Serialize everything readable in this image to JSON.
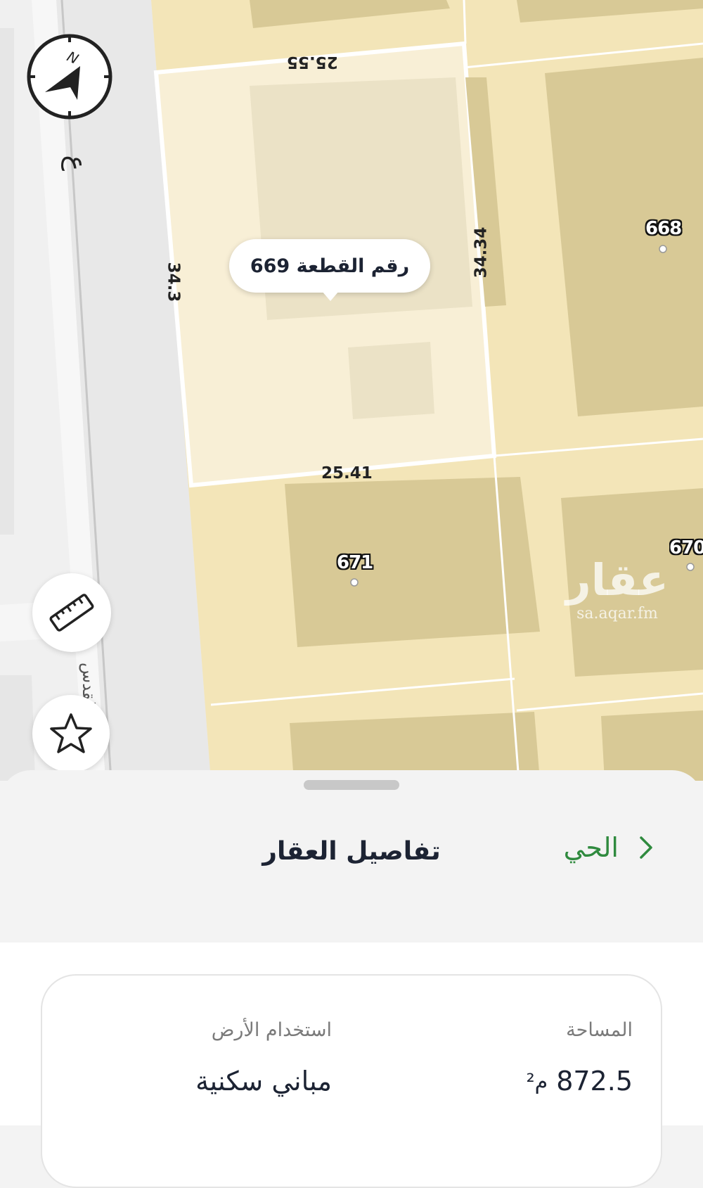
{
  "map": {
    "compass_label": "N",
    "street_label_top": "ع",
    "street_label_bottom": "القدس",
    "selected_plot_tooltip": "رقم القطعة 669",
    "plots": [
      {
        "number": "668"
      },
      {
        "number": "671"
      },
      {
        "number": "670"
      }
    ],
    "dimensions": {
      "top": "25.55",
      "bottom": "25.41",
      "left": "34.3",
      "right": "34.34"
    },
    "watermark": {
      "logo": "عقار",
      "url": "sa.aqar.fm"
    }
  },
  "sheet": {
    "title": "تفاصيل العقار",
    "district_link": "الحي",
    "fields": {
      "area_label": "المساحة",
      "area_value": "872.5",
      "area_unit": "م²",
      "land_use_label": "استخدام الأرض",
      "land_use_value": "مباني سكنية"
    }
  },
  "colors": {
    "parcel": "#f3e5b8",
    "building": "#d8c996",
    "selected_parcel": "#f8efd6",
    "road": "#e9e9e9",
    "accent_green": "#2f8a3e",
    "text_dark": "#1c2333"
  }
}
